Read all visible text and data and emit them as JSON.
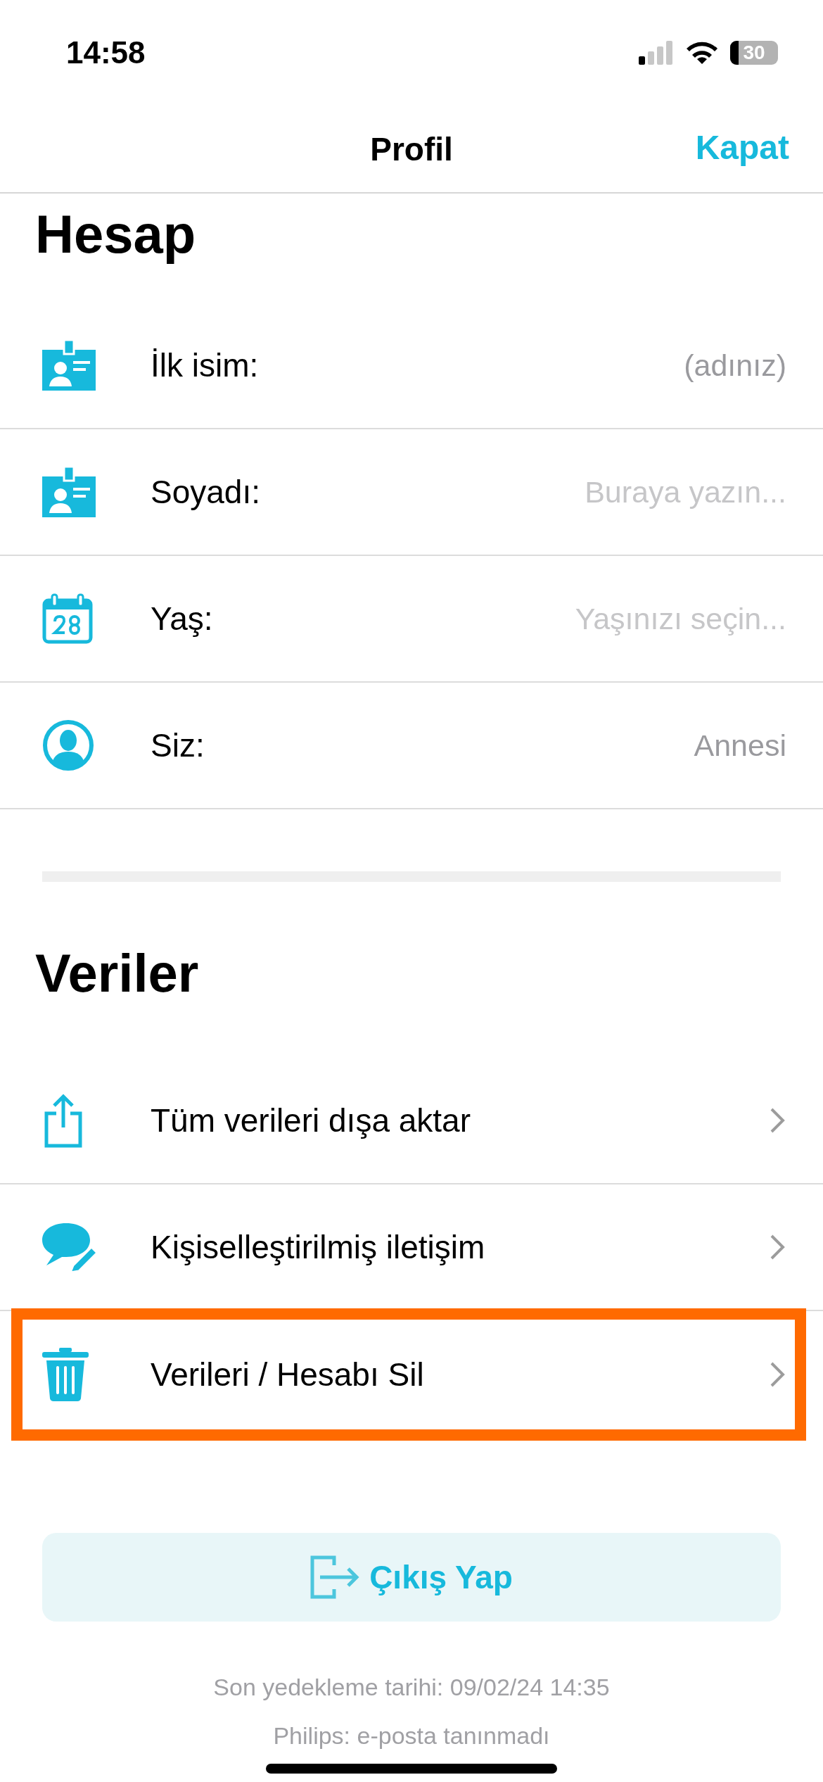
{
  "status_bar": {
    "time": "14:58",
    "battery": "30"
  },
  "nav": {
    "title": "Profil",
    "close": "Kapat"
  },
  "sections": [
    {
      "title": "Hesap",
      "rows": [
        {
          "label": "İlk isim:",
          "value": "(adınız)",
          "kind": "value"
        },
        {
          "label": "Soyadı:",
          "value": "Buraya yazın...",
          "kind": "placeholder"
        },
        {
          "label": "Yaş:",
          "value": "Yaşınızı seçin...",
          "kind": "placeholder"
        },
        {
          "label": "Siz:",
          "value": "Annesi",
          "kind": "value"
        }
      ]
    },
    {
      "title": "Veriler",
      "rows": [
        {
          "label": "Tüm verileri dışa aktar",
          "kind": "link",
          "highlighted": false
        },
        {
          "label": "Kişiselleştirilmiş iletişim",
          "kind": "link",
          "highlighted": false
        },
        {
          "label": "Verileri / Hesabı Sil",
          "kind": "link",
          "highlighted": true
        }
      ]
    }
  ],
  "logout": {
    "label": "Çıkış Yap"
  },
  "footer": [
    "Son yedekleme tarihi: 09/02/24 14:35",
    "Philips: e-posta tanınmadı"
  ]
}
